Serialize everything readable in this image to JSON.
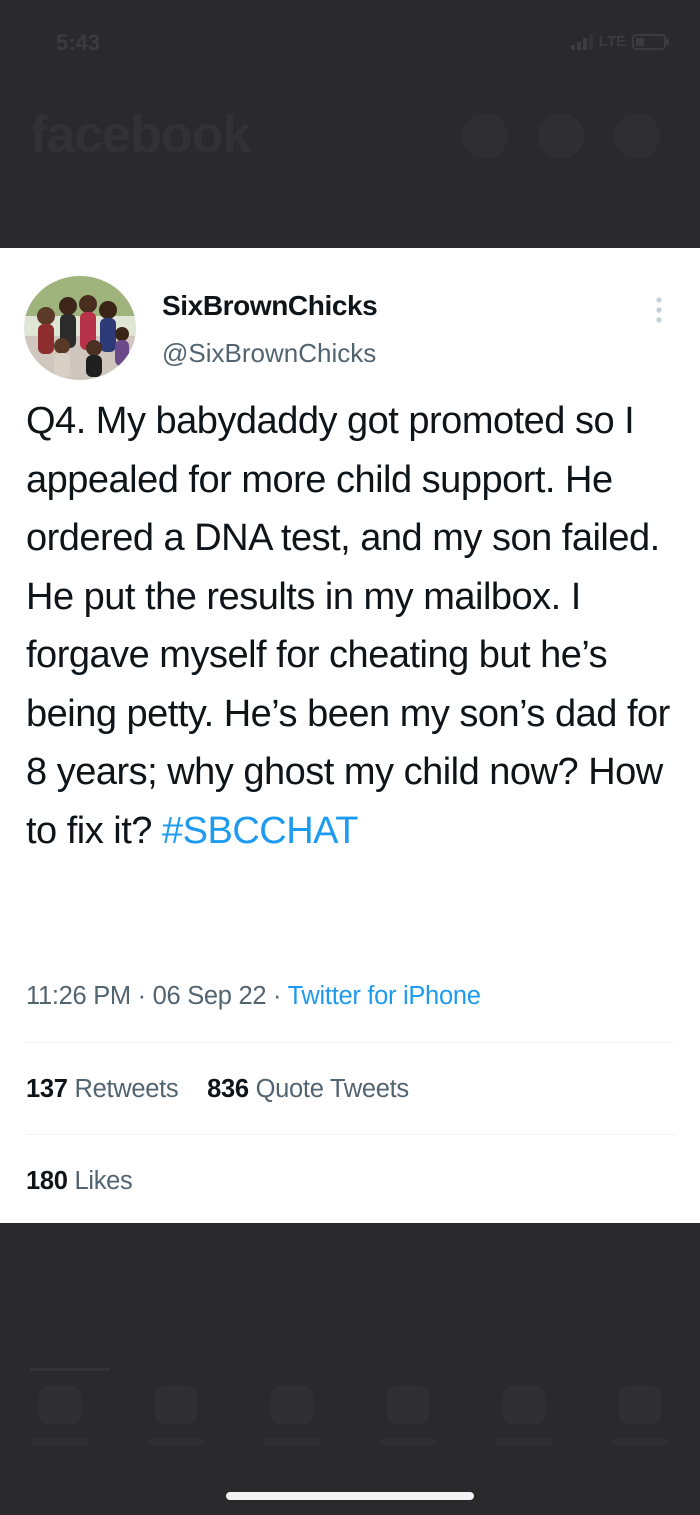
{
  "status_bar": {
    "time": "5:43",
    "network": "LTE"
  },
  "background_app": {
    "title": "facebook"
  },
  "tweet": {
    "display_name": "SixBrownChicks",
    "handle": "@SixBrownChicks",
    "body": "Q4. My babydaddy got promoted so I appealed for more child support. He ordered a DNA test, and my son failed. He put the results in my mailbox. I forgave myself for cheating but he’s being petty. He’s been my son’s dad for 8 years; why ghost my child now? How to fix it?",
    "hashtag": "#SBCCHAT",
    "time": "11:26 PM",
    "date": "06 Sep 22",
    "source": "Twitter for iPhone",
    "retweets_count": "137",
    "retweets_label": "Retweets",
    "quote_tweets_count": "836",
    "quote_tweets_label": "Quote Tweets",
    "likes_count": "180",
    "likes_label": "Likes"
  },
  "colors": {
    "link_blue": "#1d9bf0",
    "text_primary": "#0f1419",
    "text_secondary": "#536471",
    "backdrop": "#2a2a2c"
  }
}
